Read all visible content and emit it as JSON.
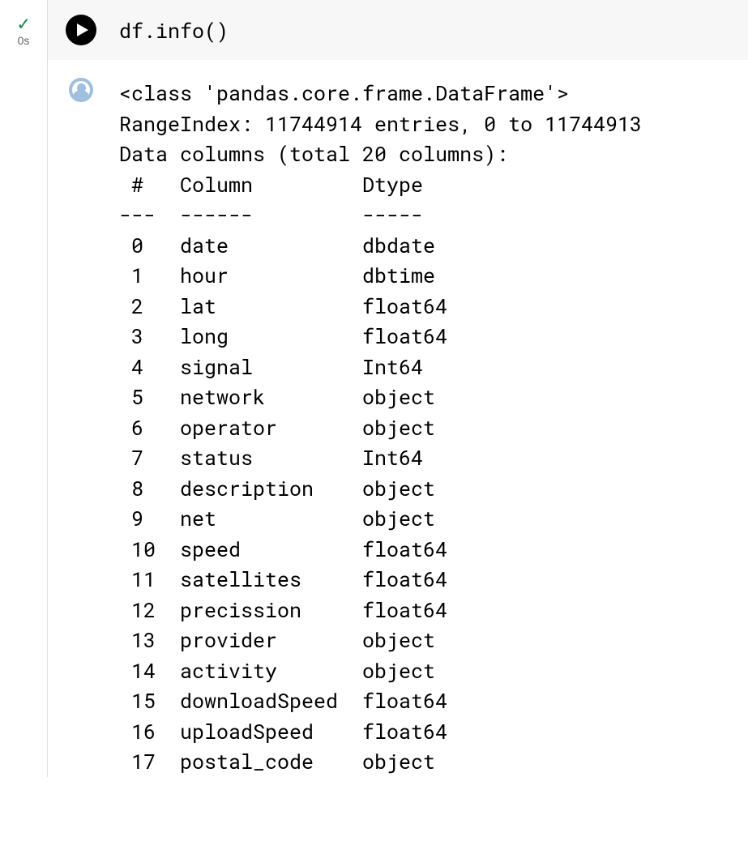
{
  "gutter": {
    "status_icon": "✓",
    "exec_time": "0s"
  },
  "code": {
    "expr": "df.info",
    "parens": "()"
  },
  "output": {
    "class_line": "<class 'pandas.core.frame.DataFrame'>",
    "range_line": "RangeIndex: 11744914 entries, 0 to 11744913",
    "cols_line": "Data columns (total 20 columns):",
    "header": " #   Column         Dtype  ",
    "divider": "---  ------         -----  ",
    "rows": [
      " 0   date           dbdate ",
      " 1   hour           dbtime ",
      " 2   lat            float64",
      " 3   long           float64",
      " 4   signal         Int64  ",
      " 5   network        object ",
      " 6   operator       object ",
      " 7   status         Int64  ",
      " 8   description    object ",
      " 9   net            object ",
      " 10  speed          float64",
      " 11  satellites     float64",
      " 12  precission     float64",
      " 13  provider       object ",
      " 14  activity       object ",
      " 15  downloadSpeed  float64",
      " 16  uploadSpeed    float64",
      " 17  postal_code    object "
    ]
  }
}
